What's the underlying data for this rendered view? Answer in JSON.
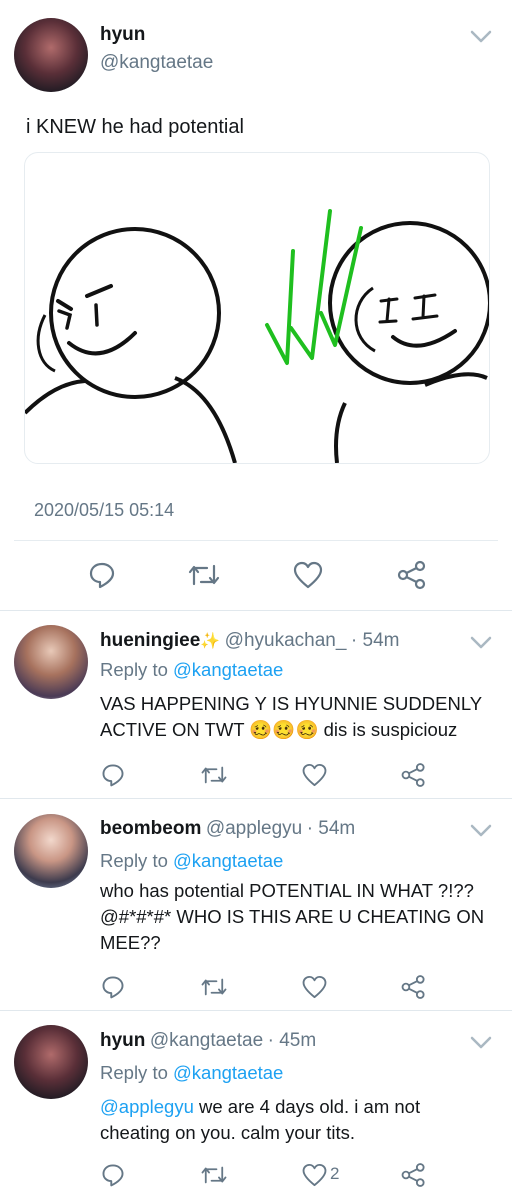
{
  "tweet": {
    "author_name": "hyun",
    "author_handle": "@kangtaetae",
    "text": "i KNEW he had potential",
    "timestamp": "2020/05/15 05:14"
  },
  "replies": [
    {
      "author_name": "hueningiee",
      "author_handle": "@hyukachan_",
      "time": "· 54m",
      "reply_to_label": "Reply to",
      "reply_to_handle": "@kangtaetae",
      "text_line1": "VAS HAPPENING Y IS HYUNNIE SUDDENLY",
      "text_line2_a": "ACTIVE ON TWT",
      "text_line2_emoji": "🥴🥴🥴",
      "text_line2_b": "dis is suspiciouz"
    },
    {
      "author_name": "beombeom",
      "author_handle": "@applegyu",
      "time": "· 54m",
      "reply_to_label": "Reply to",
      "reply_to_handle": "@kangtaetae",
      "text_line1": "who has potential POTENTIAL IN WHAT ?!??",
      "text_line2": "@#*#*#* WHO IS THIS ARE U CHEATING ON",
      "text_line3": "MEE??"
    },
    {
      "author_name": "hyun",
      "author_handle": "@kangtaetae",
      "time": "· 45m",
      "reply_to_label": "Reply to",
      "reply_to_handle": "@kangtaetae",
      "mention": "@applegyu",
      "text_line1_rest": "we are 4 days old. i am not",
      "text_line2": "cheating on you. calm your tits.",
      "like_count": "2"
    }
  ],
  "colors": {
    "link": "#1da1f2",
    "muted": "#657786",
    "divider": "#e1e8ed",
    "doodle_green": "#1fbf1f"
  }
}
